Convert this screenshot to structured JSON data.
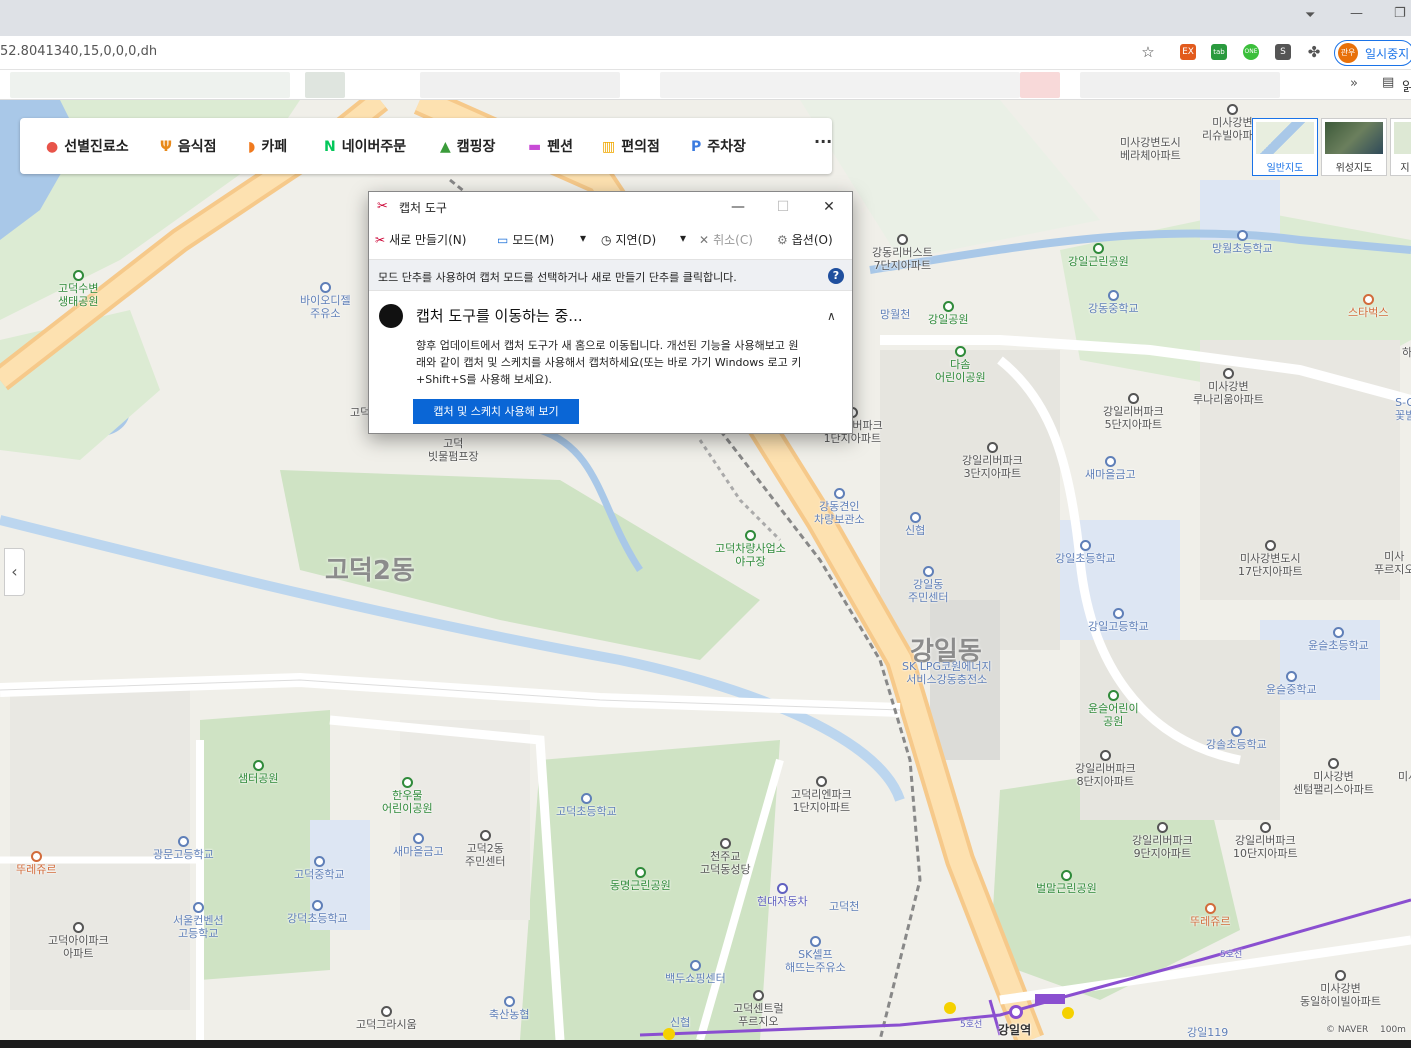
{
  "browser": {
    "url": "52.8041340,15,0,0,0,dh",
    "profile_initials": "관우",
    "profile_label": "일시중지",
    "ext_labels": [
      "EX",
      "tab",
      "ONE",
      "S"
    ],
    "bookmarks_overflow": "»",
    "reading_list_label": "읽"
  },
  "categories": [
    {
      "label": "선별진료소",
      "icon": "pin-icon",
      "glyph": "●",
      "color": "#e8544a"
    },
    {
      "label": "음식점",
      "icon": "fork-knife-icon",
      "glyph": "Ψ",
      "color": "#e8891a"
    },
    {
      "label": "카페",
      "icon": "cup-icon",
      "glyph": "◗",
      "color": "#f07a1e"
    },
    {
      "label": "네이버주문",
      "icon": "naver-n-icon",
      "glyph": "N",
      "color": "#03c75a"
    },
    {
      "label": "캠핑장",
      "icon": "tent-icon",
      "glyph": "▲",
      "color": "#3a9b3a"
    },
    {
      "label": "펜션",
      "icon": "bed-icon",
      "glyph": "▬",
      "color": "#c84bd6"
    },
    {
      "label": "편의점",
      "icon": "store-icon",
      "glyph": "▥",
      "color": "#f0a800"
    },
    {
      "label": "주차장",
      "icon": "parking-icon",
      "glyph": "P",
      "color": "#3b7be0"
    }
  ],
  "more_label": "···",
  "layers": [
    {
      "label": "일반지도",
      "selected": true
    },
    {
      "label": "위성지도",
      "selected": false
    },
    {
      "label": "지",
      "selected": false
    }
  ],
  "map_labels": {
    "l1": "고덕수변\n생태공원",
    "l2": "바이오디젤\n주유소",
    "l3": "고덕",
    "l4": "고덕\n빗물펌프장",
    "l5": "고덕2동",
    "l6": "고덕차량사업소\n야구장",
    "l7": "강동견인\n차량보관소",
    "l8": "강동리버스트\n7단지아파트",
    "l9": "망월천",
    "l10": "강일공원",
    "l11": "다솜\n어린이공원",
    "l12": "강일리버파크\n1단지아파트",
    "l13": "신협",
    "l14": "강일동\n주민센터",
    "l15": "강일동",
    "l16": "SK LPG코원에너지\n서비스강동충전소",
    "l17": "강일근린공원",
    "l18": "강동중학교",
    "l19": "강일리버파크\n5단지아파트",
    "l20": "강일리버파크\n3단지아파트",
    "l21": "새마을금고",
    "l22": "강일초등학교",
    "l23": "강일고등학교",
    "l24": "윤슬어린이\n공원",
    "l25": "강일리버파크\n8단지아파트",
    "l26": "강일리버파크\n9단지아파트",
    "l27": "강일리버파크\n10단지아파트",
    "l28": "벌말근린공원",
    "l29": "뚜레쥬르",
    "l30": "미사강변도시\n베라체아파트",
    "l31": "미사강변\n리슈빌아파트",
    "l32": "망월초등학교",
    "l33": "스타벅스",
    "l34": "미사강변\n루나리움아파트",
    "l35": "미사강변도시\n17단지아파트",
    "l36": "윤슬초등학교",
    "l37": "윤슬중학교",
    "l38": "강솔초등학교",
    "l39": "미사강변\n센텀팰리스아파트",
    "l40": "미사강변\n동일하이빌아파트",
    "l41": "샘터공원",
    "l42": "한우물\n어린이공원",
    "l43": "광문고등학교",
    "l44": "고덕중학교",
    "l45": "강덕초등학교",
    "l46": "서울컨벤션\n고등학교",
    "l47": "뚜레쥬르",
    "l48": "고덕아이파크\n아파트",
    "l49": "새마을금고",
    "l50": "고덕2동\n주민센터",
    "l51": "고덕초등학교",
    "l52": "천주교\n고덕동성당",
    "l53": "동명근린공원",
    "l54": "현대자동차",
    "l55": "고덕천",
    "l56": "SK셀프\n해뜨는주유소",
    "l57": "백두쇼핑센터",
    "l58": "고덕센트럴\n푸르지오",
    "l59": "신협",
    "l60": "축산농협",
    "l61": "고덕그라시움",
    "l62": "고덕리엔파크\n1단지아파트",
    "l63": "강일역",
    "l64": "5호선",
    "l65": "5호선",
    "l66": "강일119",
    "l67": "미사\n푸르지오",
    "l68": "S-O\n꽃빌",
    "l69": "미사",
    "l70": "하",
    "scale": "100m",
    "naver": "© NAVER"
  },
  "snip": {
    "title": "캡처 도구",
    "new_label": "새로 만들기(N)",
    "mode_label": "모드(M)",
    "delay_label": "지연(D)",
    "cancel_label": "취소(C)",
    "options_label": "옵션(O)",
    "hint": "모드 단추를 사용하여 캡처 모드를 선택하거나 새로 만들기 단추를 클릭합니다.",
    "notice_title": "캡처 도구를 이동하는 중...",
    "notice_body": "향후 업데이트에서 캡처 도구가 새 홈으로 이동됩니다. 개선된 기능을 사용해보고 원래와 같이 캡처 및 스케치를 사용해서 캡처하세요(또는 바로 가기 Windows 로고 키+Shift+S를 사용해 보세요).",
    "notice_button": "캡처 및 스케치 사용해 보기",
    "minimize": "—",
    "maximize": "☐",
    "close": "✕",
    "help": "?"
  }
}
